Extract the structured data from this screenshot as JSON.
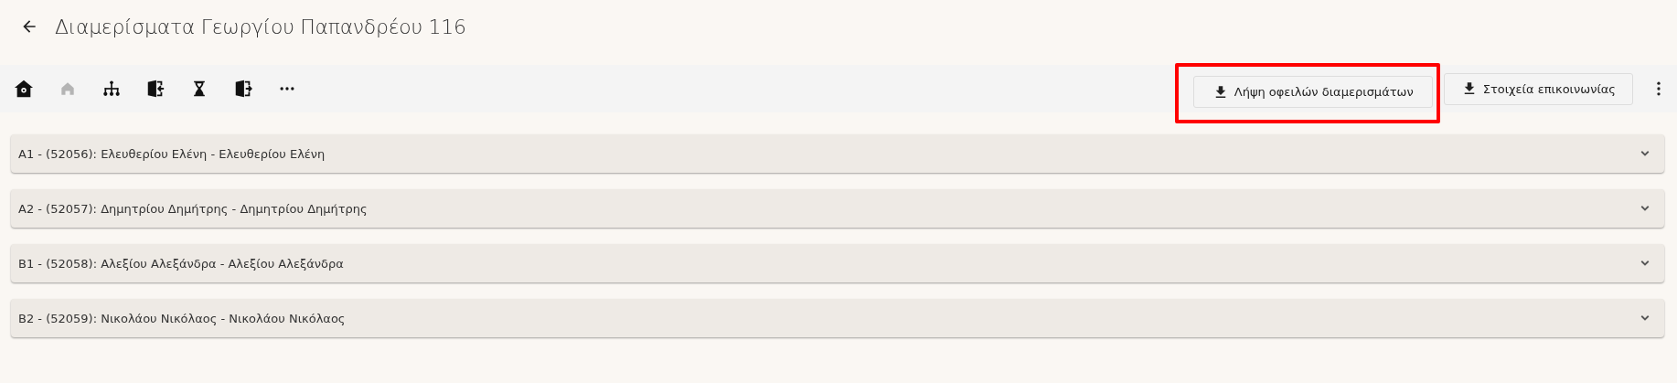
{
  "header": {
    "title": "Διαμερίσματα Γεωργίου Παπανδρέου 116"
  },
  "toolbar": {
    "icons": [
      {
        "kind": "building",
        "disabled": false
      },
      {
        "kind": "home",
        "disabled": true
      },
      {
        "kind": "hierarchy",
        "disabled": false
      },
      {
        "kind": "enter",
        "disabled": false
      },
      {
        "kind": "hourglass",
        "disabled": false
      },
      {
        "kind": "exit",
        "disabled": false
      },
      {
        "kind": "more",
        "disabled": false
      }
    ],
    "buttons": [
      {
        "label": "Λήψη οφειλών διαμερισμάτων",
        "highlighted": true
      },
      {
        "label": "Στοιχεία επικοινωνίας",
        "highlighted": false
      }
    ]
  },
  "apartments": [
    {
      "label": "A1 - (52056): Ελευθερίου Ελένη - Ελευθερίου Ελένη",
      "expanded": false
    },
    {
      "label": "A2 - (52057): Δημητρίου Δημήτρης - Δημητρίου Δημήτρης",
      "expanded": false
    },
    {
      "label": "B1 - (52058): Αλεξίου Αλεξάνδρα - Αλεξίου Αλεξάνδρα",
      "expanded": false
    },
    {
      "label": "B2 - (52059): Νικολάου Νικόλαος - Νικολάου Νικόλαος",
      "expanded": false
    }
  ]
}
